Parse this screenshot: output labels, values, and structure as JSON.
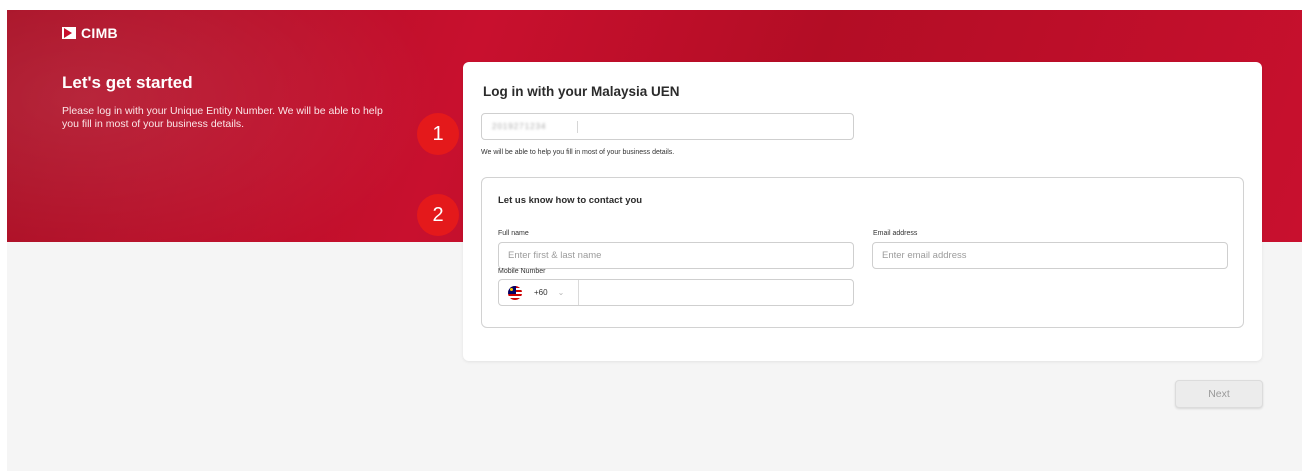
{
  "brand": {
    "name": "CIMB",
    "logo_icon": "cimb-arrow-logo",
    "primary_color": "#c8102e"
  },
  "hero": {
    "title": "Let's get started",
    "subtitle": "Please log in with your Unique Entity Number. We will be able to help you fill in most of your business details."
  },
  "login": {
    "title": "Log in with your Malaysia UEN",
    "uen_value": "2019271234",
    "helper_text": "We will be able to help you fill in most of your business details."
  },
  "contact": {
    "title": "Let us know how to contact you",
    "full_name_label": "Full name",
    "full_name_placeholder": "Enter first & last name",
    "email_label": "Email address",
    "email_placeholder": "Enter email address",
    "mobile_label": "Mobile Number",
    "country_flag": "malaysia-flag-icon",
    "dial_code": "+60"
  },
  "annotations": {
    "step1": "1",
    "step2": "2",
    "badge_color": "#e4191b"
  },
  "actions": {
    "next_label": "Next"
  }
}
